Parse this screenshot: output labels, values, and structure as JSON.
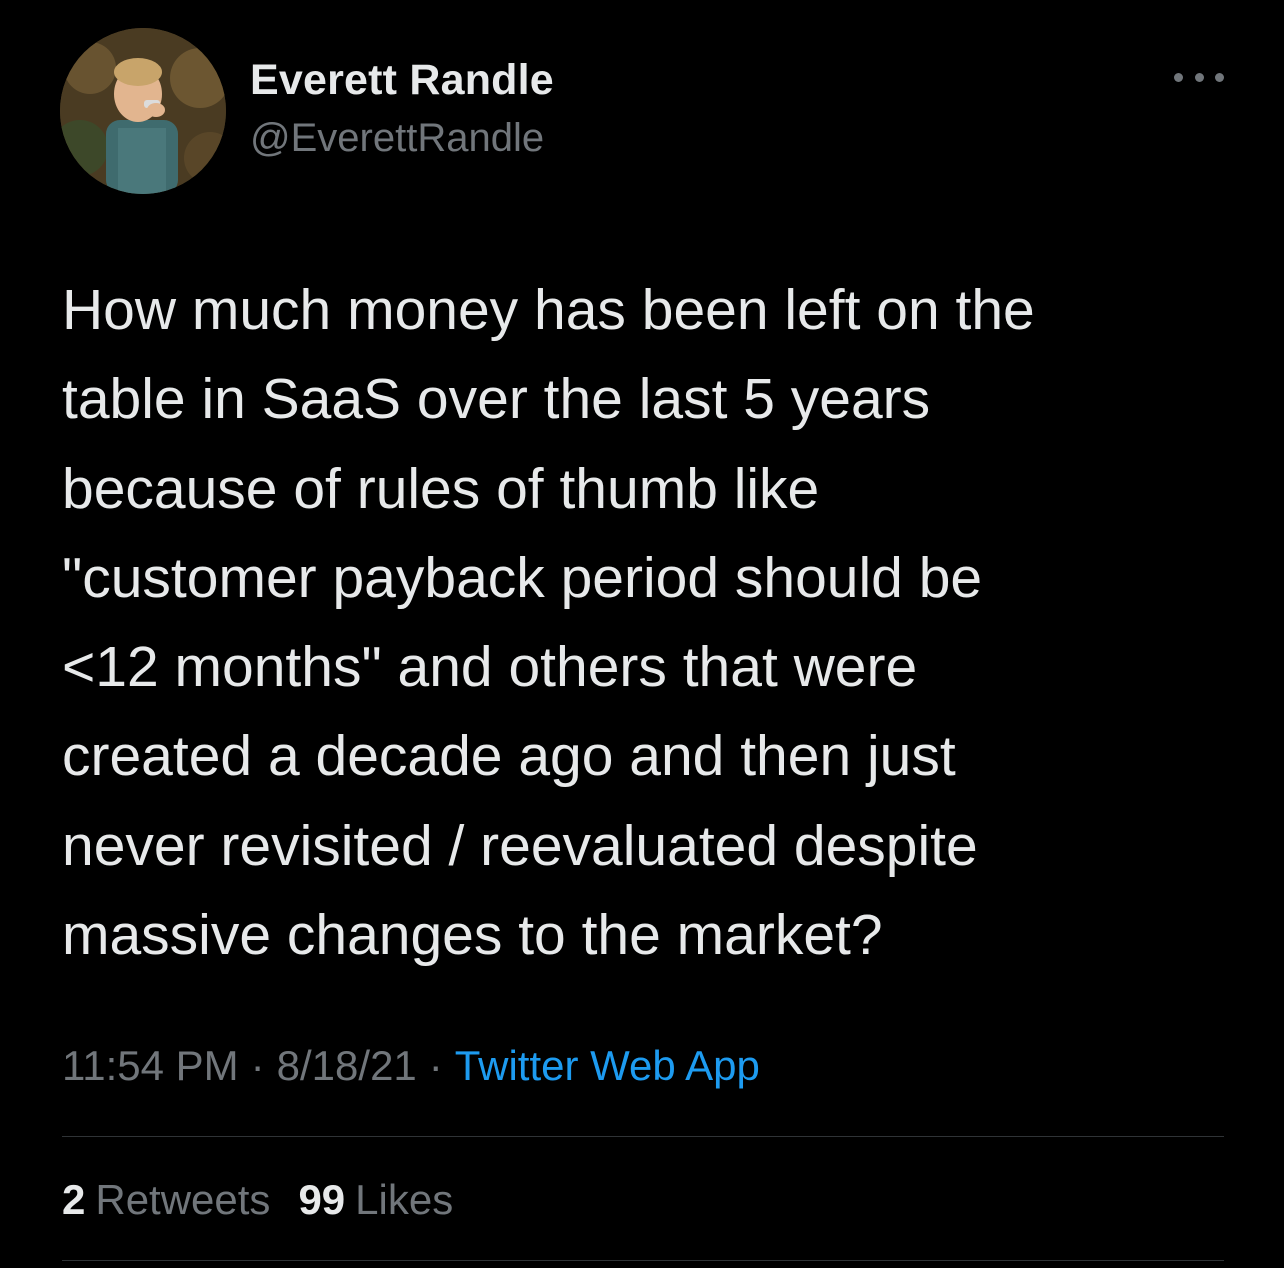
{
  "author": {
    "name": "Everett Randle",
    "handle": "@EverettRandle"
  },
  "tweet": {
    "lines": [
      "How much money has been left on the",
      "table in SaaS over the last 5 years",
      "because of rules of thumb like",
      "\"customer payback period should be",
      "<12 months\" and others that were",
      "created a decade ago and then just",
      "never revisited / reevaluated despite",
      "massive changes to the market?"
    ]
  },
  "meta": {
    "time": "11:54 PM",
    "separator": "·",
    "date": "8/18/21",
    "source": "Twitter Web App"
  },
  "stats": {
    "retweets_count": "2",
    "retweets_label": "Retweets",
    "likes_count": "99",
    "likes_label": "Likes"
  },
  "icons": {
    "more": "more-horizontal-icon"
  },
  "colors": {
    "background": "#000000",
    "text": "#e7e9ea",
    "secondary": "#71767b",
    "link": "#1d9bf0",
    "divider": "#2f3336"
  }
}
